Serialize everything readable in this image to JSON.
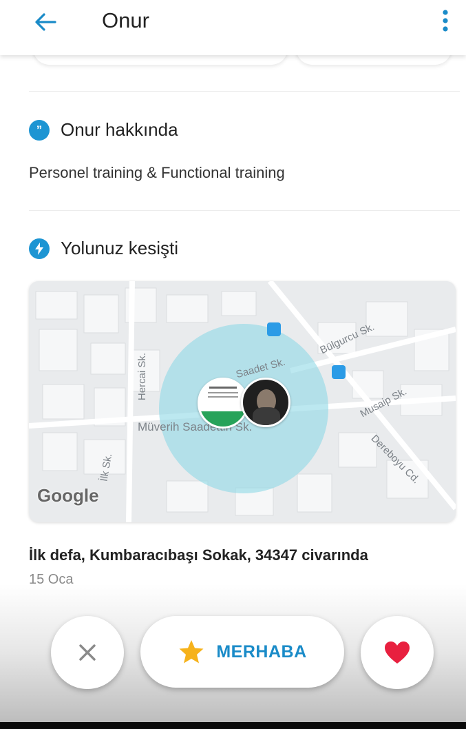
{
  "header": {
    "title": "Onur"
  },
  "about": {
    "heading": "Onur hakkında",
    "text": "Personel training & Functional training"
  },
  "crossed": {
    "heading": "Yolunuz kesişti",
    "map": {
      "streets": [
        "Hercai Sk.",
        "Saadet Sk.",
        "Bülgurcu Sk.",
        "Müverih Saadettin Sk.",
        "Musaip Sk.",
        "Dereboyu Cd.",
        "İlk Sk."
      ],
      "provider": "Google"
    },
    "location": "İlk defa, Kumbaracıbaşı Sokak, 34347 civarında",
    "date": "15 Oca"
  },
  "actions": {
    "hello_label": "MERHABA"
  },
  "colors": {
    "accent": "#1d95d3",
    "heart": "#e8203f",
    "star": "#f6b21b"
  }
}
